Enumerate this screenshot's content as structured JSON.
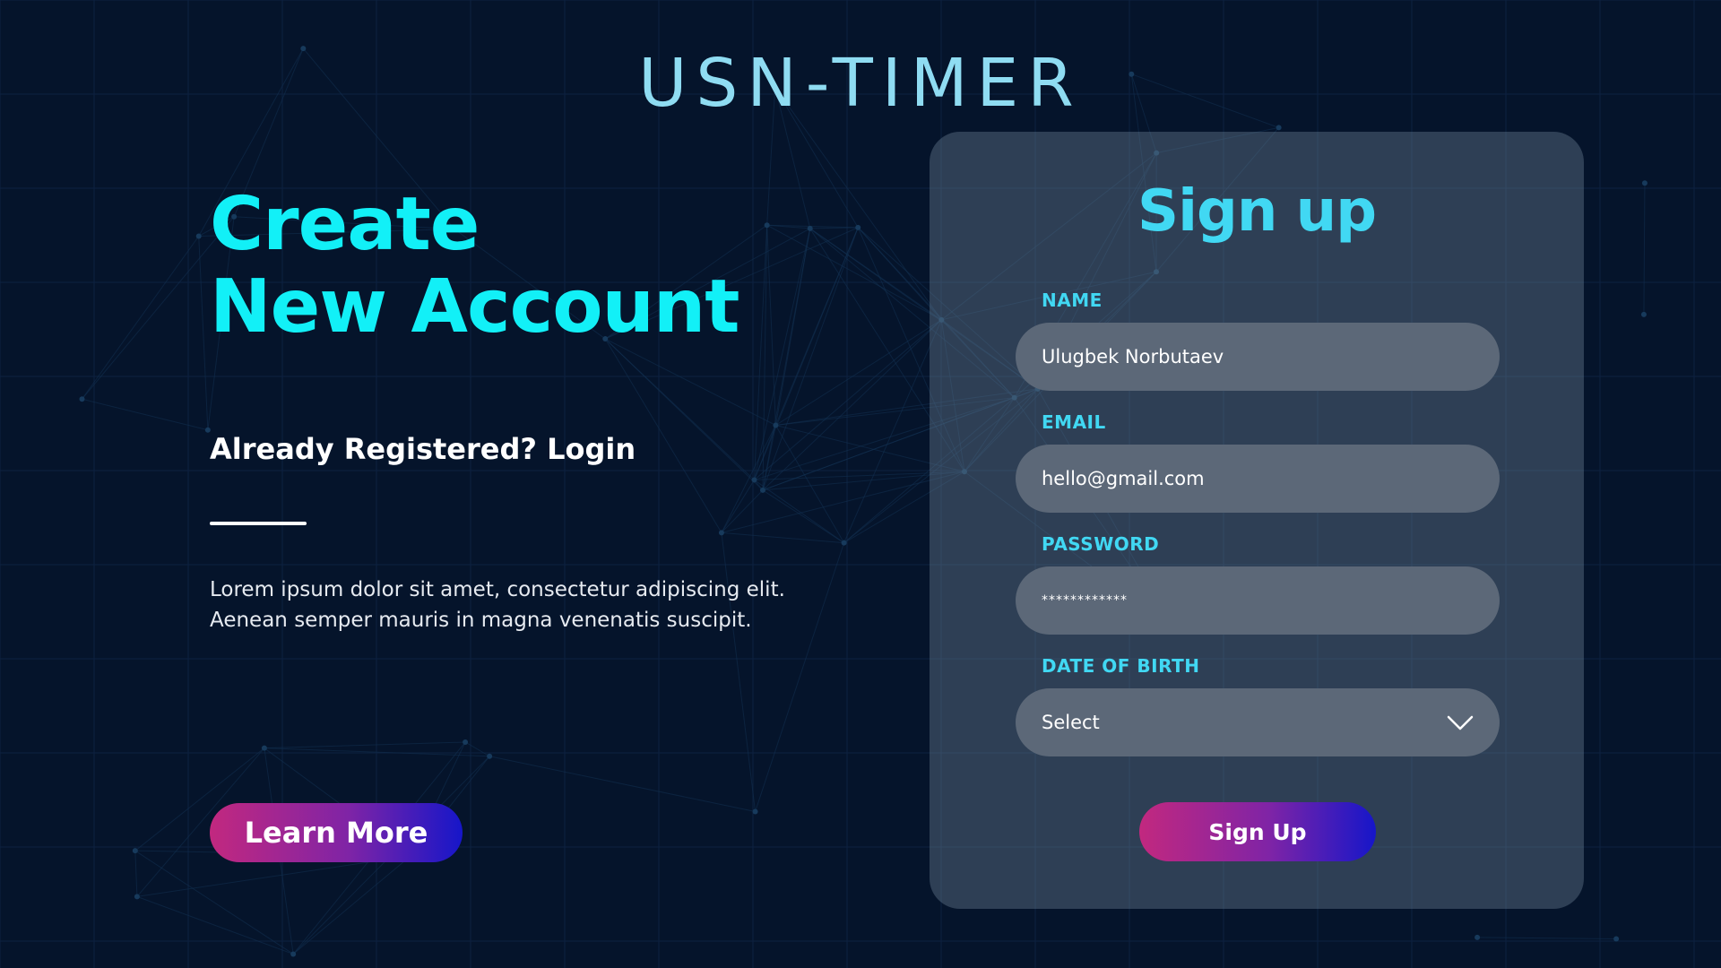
{
  "app": {
    "logo": "USN-TIMER"
  },
  "hero": {
    "title_line1": "Create",
    "title_line2": "New Account",
    "login_link": "Already Registered? Login",
    "description_line1": "Lorem ipsum dolor sit amet, consectetur adipiscing elit.",
    "description_line2": "Aenean semper mauris in magna venenatis suscipit.",
    "learn_more": "Learn More"
  },
  "form": {
    "title": "Sign up",
    "fields": {
      "name": {
        "label": "NAME",
        "value": "Ulugbek Norbutaev"
      },
      "email": {
        "label": "EMAIL",
        "value": "hello@gmail.com"
      },
      "password": {
        "label": "PASSWORD",
        "value": "************"
      },
      "dob": {
        "label": "DATE OF BIRTH",
        "value": "Select",
        "icon": "chevron-down-icon"
      }
    },
    "submit": "Sign Up"
  },
  "colors": {
    "background": "#05142b",
    "accent_cyan": "#12f0f7",
    "label_cyan": "#41d8f3",
    "logo": "#8fdcf2",
    "gradient_start": "#c2287f",
    "gradient_end": "#1616c9",
    "input_fill": "#5c6878"
  }
}
